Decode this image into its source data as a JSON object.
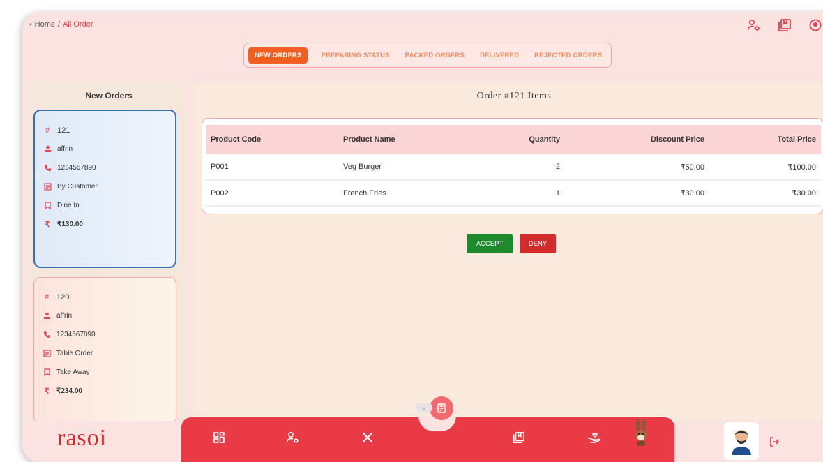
{
  "breadcrumb": {
    "home": "Home",
    "separator": "/",
    "current": "All Order"
  },
  "tabs": [
    {
      "label": "NEW ORDERS",
      "active": true
    },
    {
      "label": "PREPARING STATUS",
      "active": false
    },
    {
      "label": "PACKED ORDERS",
      "active": false
    },
    {
      "label": "DELIVERED",
      "active": false
    },
    {
      "label": "REJECTED ORDERS",
      "active": false
    }
  ],
  "left_panel": {
    "title": "New Orders",
    "orders": [
      {
        "id": "121",
        "name": "affrin",
        "phone": "1234567890",
        "source": "By Customer",
        "type": "Dine In",
        "total": "₹130.00"
      },
      {
        "id": "120",
        "name": "affrin",
        "phone": "1234567890",
        "source": "Table Order",
        "type": "Take Away",
        "total": "₹234.00"
      }
    ]
  },
  "main": {
    "title": "Order #121 Items",
    "columns": [
      "Product Code",
      "Product Name",
      "Quantity",
      "Discount Price",
      "Total Price"
    ],
    "rows": [
      [
        "P001",
        "Veg Burger",
        "2",
        "₹50.00",
        "₹100.00"
      ],
      [
        "P002",
        "French Fries",
        "1",
        "₹30.00",
        "₹30.00"
      ]
    ],
    "accept_label": "ACCEPT",
    "deny_label": "DENY"
  },
  "brand": {
    "logo_text": "rasoi"
  },
  "colors": {
    "accent": "#ea3a46",
    "tab_active": "#f05f22",
    "accept": "#1e8a2e",
    "deny": "#d12b2b",
    "background": "#fbe3e2"
  },
  "icons": {
    "top": [
      "user-settings-icon",
      "book-icon",
      "location-icon"
    ],
    "nav": [
      "dashboard-icon",
      "user-settings-icon",
      "utensils-icon",
      "book-icon",
      "hand-heart-icon"
    ]
  }
}
